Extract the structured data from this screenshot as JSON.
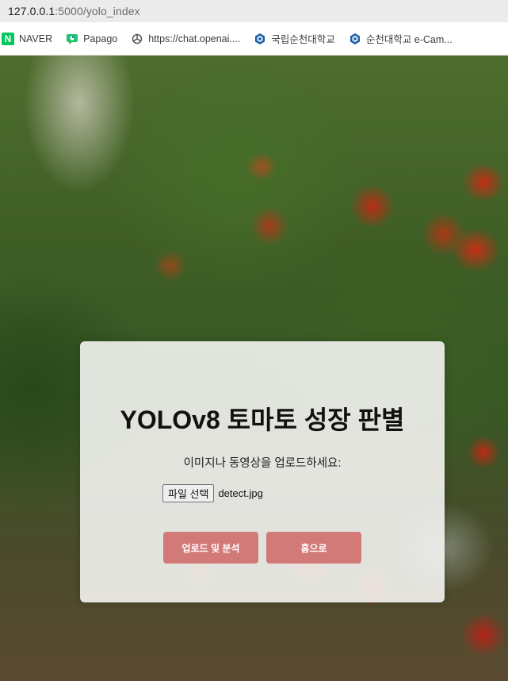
{
  "browser": {
    "url_host": "127.0.0.1",
    "url_path": ":5000/yolo_index"
  },
  "bookmarks": [
    {
      "label": "NAVER",
      "icon": "naver-icon"
    },
    {
      "label": "Papago",
      "icon": "papago-icon"
    },
    {
      "label": "https://chat.openai....",
      "icon": "openai-icon"
    },
    {
      "label": "국립순천대학교",
      "icon": "university-icon"
    },
    {
      "label": "순천대학교 e-Cam...",
      "icon": "university-icon"
    }
  ],
  "card": {
    "title": "YOLOv8 토마토 성장 판별",
    "subtitle": "이미지나 동영상을 업로드하세요:",
    "file_button": "파일 선택",
    "file_name": "detect.jpg",
    "upload_button": "업로드 및 분석",
    "home_button": "홈으로"
  },
  "colors": {
    "button": "#d27a78",
    "card_background": "#f4f4f2"
  }
}
